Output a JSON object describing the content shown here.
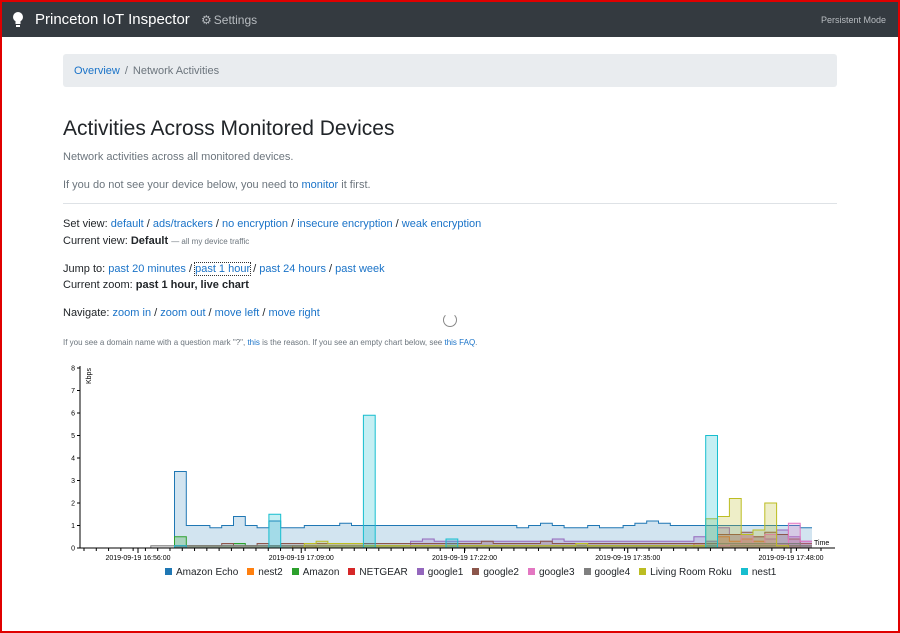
{
  "navbar": {
    "brand": "Princeton IoT Inspector",
    "settings_label": "Settings",
    "mode_label": "Persistent Mode"
  },
  "breadcrumb": {
    "home": "Overview",
    "current": "Network Activities"
  },
  "page": {
    "title": "Activities Across Monitored Devices",
    "subtitle": "Network activities across all monitored devices.",
    "monitor_prefix": "If you do not see your device below, you need to",
    "monitor_link": "monitor",
    "monitor_suffix": "it first."
  },
  "view": {
    "label": "Set view:",
    "options": [
      "default",
      "ads/trackers",
      "no encryption",
      "insecure encryption",
      "weak encryption"
    ],
    "current_label": "Current view:",
    "current_value": "Default",
    "current_note": "— all my device traffic"
  },
  "jump": {
    "label": "Jump to:",
    "options": [
      "past 20 minutes",
      "past 1 hour",
      "past 24 hours",
      "past week"
    ],
    "zoom_label": "Current zoom:",
    "zoom_value": "past 1 hour, live chart"
  },
  "navigate": {
    "label": "Navigate:",
    "options": [
      "zoom in",
      "zoom out",
      "move left",
      "move right"
    ]
  },
  "note": {
    "part1": "If you see a domain name with a question mark \"?\",",
    "link1": "this",
    "part2": "is the reason. If you see an empty chart below, see",
    "link2": "this FAQ",
    "part3": "."
  },
  "chart_data": {
    "type": "area",
    "ylabel": "Kbps",
    "xlabel": "Time",
    "ylim": [
      0,
      8
    ],
    "yticks": [
      "0",
      "1",
      "2",
      "3",
      "4",
      "5",
      "6",
      "7",
      "8"
    ],
    "xticks": [
      "2019-09-19 16:56:00",
      "2019-09-19 17:09:00",
      "2019-09-19 17:22:00",
      "2019-09-19 17:35:00",
      "2019-09-19 17:48:00"
    ],
    "grid": false,
    "legend_position": "bottom",
    "series": [
      {
        "name": "Amazon Echo",
        "color": "#1f77b4",
        "values": [
          0,
          0,
          0,
          0,
          0,
          0,
          0,
          0,
          3.4,
          1.0,
          1.0,
          0.9,
          1.0,
          1.4,
          1.0,
          0.9,
          1.2,
          0.9,
          0.9,
          1.0,
          1.0,
          1.0,
          1.1,
          1.0,
          1.0,
          1.0,
          1.0,
          1.0,
          1.0,
          1.0,
          1.0,
          1.0,
          1.0,
          1.0,
          1.0,
          1.0,
          1.0,
          0.9,
          1.0,
          1.1,
          1.0,
          0.9,
          0.9,
          1.0,
          0.9,
          0.9,
          1.0,
          1.1,
          1.2,
          1.1,
          1.0,
          1.0,
          1.0,
          1.0,
          1.0,
          1.0,
          1.0,
          1.0,
          1.0,
          1.0,
          1.0,
          0.9
        ]
      },
      {
        "name": "nest2",
        "color": "#ff7f0e",
        "values": [
          0,
          0,
          0,
          0,
          0,
          0,
          0,
          0,
          0,
          0,
          0,
          0,
          0,
          0,
          0,
          0,
          0,
          0,
          0.1,
          0.1,
          0,
          0,
          0,
          0,
          0,
          0,
          0,
          0,
          0,
          0,
          0,
          0,
          0,
          0,
          0,
          0,
          0,
          0,
          0,
          0,
          0,
          0,
          0,
          0,
          0,
          0,
          0,
          0,
          0,
          0,
          0,
          0,
          0.2,
          0.3,
          0.5,
          0.3,
          0.4,
          0.3,
          0.2,
          0.2,
          0.1,
          0
        ]
      },
      {
        "name": "Amazon",
        "color": "#2ca02c",
        "values": [
          0,
          0,
          0,
          0,
          0,
          0,
          0,
          0,
          0.5,
          0.1,
          0.1,
          0.1,
          0.1,
          0.2,
          0.1,
          0.1,
          0.1,
          0.1,
          0.1,
          0.1,
          0.1,
          0.1,
          0.1,
          0.1,
          0.1,
          0.1,
          0.1,
          0.1,
          0.1,
          0.1,
          0.1,
          0.1,
          0.1,
          0.1,
          0.1,
          0.1,
          0.1,
          0.1,
          0.1,
          0.1,
          0.1,
          0.1,
          0.1,
          0.1,
          0.1,
          0.1,
          0.1,
          0.1,
          0.1,
          0.1,
          0.1,
          0.1,
          0.1,
          0.1,
          0.1,
          0.1,
          0.1,
          0.1,
          0.1,
          0.1,
          0.1,
          0.1
        ]
      },
      {
        "name": "NETGEAR",
        "color": "#d62728",
        "values": [
          0,
          0,
          0,
          0,
          0,
          0,
          0,
          0,
          0.1,
          0,
          0,
          0,
          0,
          0,
          0,
          0,
          0,
          0,
          0,
          0,
          0,
          0,
          0,
          0,
          0,
          0,
          0,
          0,
          0,
          0,
          0,
          0,
          0,
          0,
          0,
          0,
          0,
          0,
          0,
          0,
          0,
          0,
          0,
          0,
          0,
          0,
          0,
          0,
          0,
          0,
          0,
          0,
          0,
          0,
          0,
          0,
          0,
          0,
          0,
          0,
          0,
          0
        ]
      },
      {
        "name": "google1",
        "color": "#9467bd",
        "values": [
          0,
          0,
          0,
          0,
          0,
          0,
          0,
          0,
          0,
          0,
          0,
          0,
          0,
          0,
          0,
          0,
          0,
          0,
          0,
          0,
          0,
          0,
          0,
          0,
          0,
          0,
          0,
          0,
          0.3,
          0.4,
          0.3,
          0.3,
          0.3,
          0.3,
          0.3,
          0.3,
          0.3,
          0.3,
          0.3,
          0.3,
          0.4,
          0.3,
          0.3,
          0.3,
          0.3,
          0.3,
          0.3,
          0.3,
          0.3,
          0.3,
          0.3,
          0.3,
          0.5,
          0.3,
          0.9,
          0.6,
          0.6,
          0.5,
          0.4,
          0.8,
          0.5,
          0.3
        ]
      },
      {
        "name": "google2",
        "color": "#8c564b",
        "values": [
          0,
          0,
          0,
          0,
          0,
          0,
          0,
          0,
          0.1,
          0.1,
          0.1,
          0.1,
          0.2,
          0.1,
          0.1,
          0.2,
          0.1,
          0.2,
          0.2,
          0.2,
          0.2,
          0.2,
          0.2,
          0.2,
          0.2,
          0.2,
          0.2,
          0.2,
          0.2,
          0.2,
          0.2,
          0.2,
          0.2,
          0.2,
          0.3,
          0.2,
          0.2,
          0.2,
          0.2,
          0.3,
          0.2,
          0.2,
          0.2,
          0.2,
          0.2,
          0.2,
          0.2,
          0.2,
          0.2,
          0.2,
          0.2,
          0.2,
          0.2,
          0.2,
          0.6,
          0.6,
          0.7,
          0.5,
          0.7,
          0.6,
          0.4,
          0.2
        ]
      },
      {
        "name": "google3",
        "color": "#e377c2",
        "values": [
          0,
          0,
          0,
          0,
          0,
          0,
          0,
          0,
          0,
          0,
          0,
          0,
          0,
          0,
          0,
          0,
          0,
          0,
          0,
          0,
          0,
          0,
          0,
          0,
          0,
          0,
          0,
          0,
          0,
          0,
          0,
          0,
          0,
          0,
          0,
          0,
          0,
          0,
          0,
          0,
          0,
          0,
          0,
          0,
          0,
          0,
          0,
          0,
          0,
          0,
          0,
          0,
          0,
          0,
          0.1,
          0.2,
          0.6,
          0.2,
          0.6,
          0.2,
          1.1,
          0.3
        ]
      },
      {
        "name": "google4",
        "color": "#7f7f7f",
        "values": [
          0,
          0,
          0,
          0,
          0,
          0,
          0.1,
          0.1,
          0.1,
          0.1,
          0.1,
          0.1,
          0.1,
          0.1,
          0.1,
          0.1,
          0.1,
          0.1,
          0.1,
          0.1,
          0.1,
          0.1,
          0.1,
          0.1,
          0.1,
          0.1,
          0.1,
          0.1,
          0.1,
          0.1,
          0.1,
          0.1,
          0.1,
          0.1,
          0.1,
          0.1,
          0.1,
          0.1,
          0.1,
          0.1,
          0.1,
          0.1,
          0.1,
          0.1,
          0.1,
          0.1,
          0.1,
          0.1,
          0.1,
          0.1,
          0.1,
          0.1,
          0.1,
          0.1,
          0.2,
          0.2,
          0.2,
          0.2,
          0.2,
          0.2,
          0.2,
          0.1
        ]
      },
      {
        "name": "Living Room Roku",
        "color": "#bcbd22",
        "values": [
          0,
          0,
          0,
          0,
          0,
          0,
          0,
          0,
          0,
          0,
          0,
          0,
          0,
          0,
          0,
          0,
          0,
          0,
          0,
          0.2,
          0.3,
          0.2,
          0.2,
          0.2,
          0.1,
          0.1,
          0.1,
          0.1,
          0.1,
          0.1,
          0.1,
          0.1,
          0.1,
          0.1,
          0.1,
          0.1,
          0.1,
          0.1,
          0.1,
          0.1,
          0.1,
          0.1,
          0.2,
          0.1,
          0.1,
          0.1,
          0.1,
          0.1,
          0.1,
          0.1,
          0.1,
          0.1,
          0.1,
          1.3,
          1.4,
          2.2,
          0.6,
          0.8,
          2.0,
          0.1,
          0,
          0
        ]
      },
      {
        "name": "nest1",
        "color": "#17becf",
        "values": [
          0,
          0,
          0,
          0,
          0,
          0,
          0,
          0,
          0.1,
          0,
          0,
          0,
          0,
          0,
          0,
          0,
          1.5,
          0,
          0,
          0,
          0,
          0,
          0,
          0,
          5.9,
          0,
          0,
          0,
          0,
          0,
          0,
          0.4,
          0,
          0,
          0,
          0,
          0,
          0,
          0,
          0,
          0,
          0,
          0,
          0,
          0,
          0,
          0,
          0,
          0,
          0,
          0,
          0,
          0,
          5.0,
          0,
          0,
          0,
          0,
          0,
          0,
          0,
          0
        ]
      }
    ]
  }
}
